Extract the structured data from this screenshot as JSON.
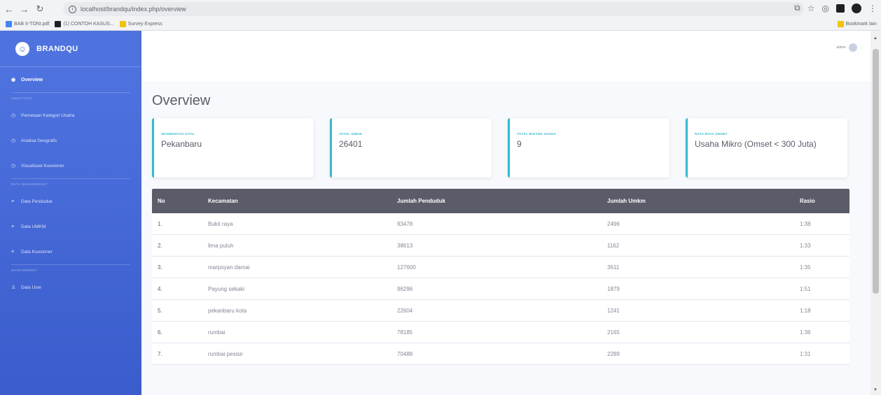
{
  "browser": {
    "url": "localhost/brandqu/index.php/overview",
    "bookmarks": [
      "BAB II-TONI.pdf",
      "(1) CONTOH KASUS...",
      "Survey Express"
    ],
    "bookmarks_right": "Bookmark lain"
  },
  "sidebar": {
    "brand": "BRANDQU",
    "overview": "Overview",
    "heading_analytics": "ANALYTICS",
    "analytics_items": [
      {
        "label": "Pemetaan Kategori Usaha",
        "icon": "chart-icon"
      },
      {
        "label": "Analisa Geografis",
        "icon": "chart-icon"
      },
      {
        "label": "Visualisasi Kuesioner",
        "icon": "chart-icon"
      }
    ],
    "heading_data": "DATA MANAGEMENT",
    "data_items": [
      {
        "label": "Data Penduduk",
        "icon": "list-icon"
      },
      {
        "label": "Data UMKM",
        "icon": "list-icon"
      },
      {
        "label": "Data Kuesioner",
        "icon": "list-icon"
      }
    ],
    "heading_management": "MANAGEMENT",
    "management_items": [
      {
        "label": "Data User",
        "icon": "user-icon"
      }
    ]
  },
  "topbar": {
    "username": "admin"
  },
  "page": {
    "title": "Overview"
  },
  "cards": [
    {
      "label": "SEGMENTASI KOTA",
      "value": "Pekanbaru"
    },
    {
      "label": "TOTAL UMKM",
      "value": "26401"
    },
    {
      "label": "TOTAL BIDANG USAHA",
      "value": "9"
    },
    {
      "label": "RATA-RATA OMSET",
      "value": "Usaha Mikro (Omset < 300 Juta)"
    }
  ],
  "table": {
    "headers": [
      "No",
      "Kecamatan",
      "Jumlah Penduduk",
      "Jumlah Umkm",
      "Rasio"
    ],
    "rows": [
      [
        "1.",
        "Bukit raya",
        "93478",
        "2496",
        "1:38"
      ],
      [
        "2.",
        "lima puluh",
        "38613",
        "1162",
        "1:33"
      ],
      [
        "3.",
        "marpoyan damai",
        "127600",
        "3611",
        "1:35"
      ],
      [
        "4.",
        "Payung sekaki",
        "96296",
        "1879",
        "1:51"
      ],
      [
        "5.",
        "pekanbaru kota",
        "22604",
        "1241",
        "1:18"
      ],
      [
        "6.",
        "rumbai",
        "78185",
        "2165",
        "1:36"
      ],
      [
        "7.",
        "rumbai pesisir",
        "70488",
        "2289",
        "1:31"
      ]
    ]
  },
  "colors": {
    "sidebar": "#4e73df",
    "card_accent": "#36b9cc",
    "table_header": "#5a5c69"
  }
}
